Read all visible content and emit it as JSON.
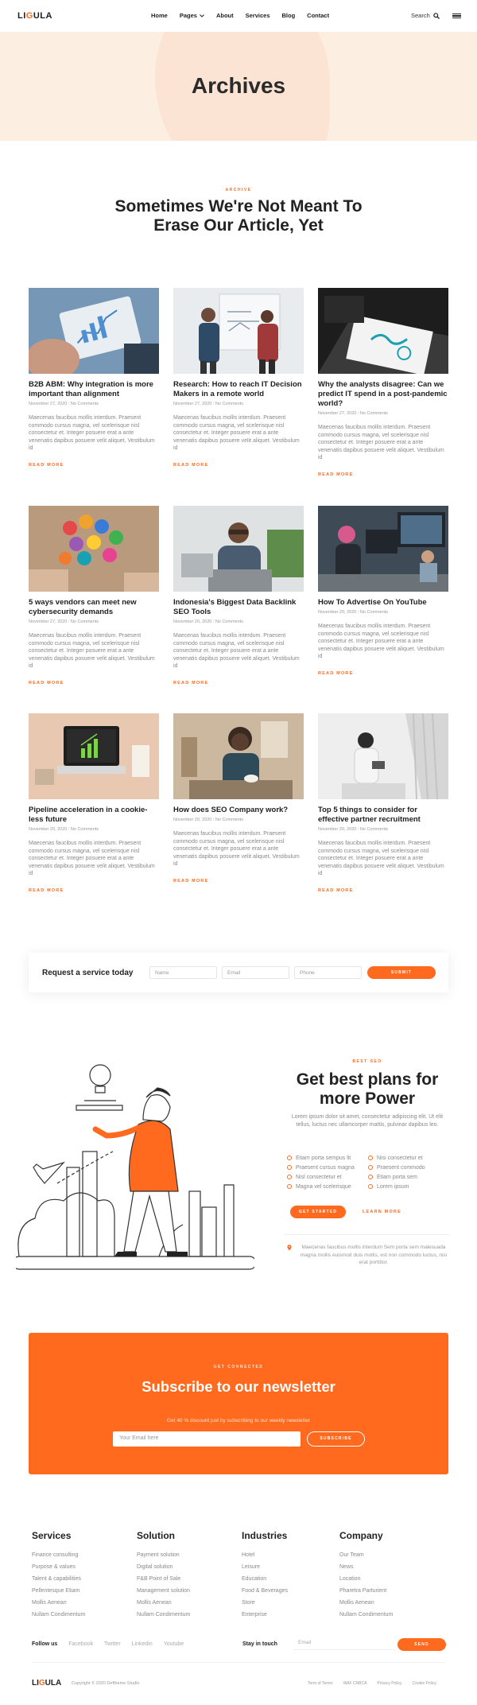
{
  "header": {
    "logo_prefix": "LI",
    "logo_accent": "G",
    "logo_suffix": "ULA",
    "nav": [
      "Home",
      "Pages",
      "About",
      "Services",
      "Blog",
      "Contact"
    ],
    "search_label": "Search"
  },
  "hero": {
    "title": "Archives"
  },
  "archive": {
    "eyebrow": "ARCHIVE",
    "title": "Sometimes We're Not Meant To Erase Our Article, Yet"
  },
  "posts": [
    {
      "title": "B2B ABM: Why integration is more important than alignment",
      "date": "November 27, 2020",
      "comments": "No Comments",
      "excerpt": "Maecenas faucibus mollis interdum. Praesent commodo cursus magna, vel scelerisque nisl consectetur et. Integer posuere erat a ante venenatis dapibus posuere velit aliquet. Vestibulum id",
      "more": "READ MORE"
    },
    {
      "title": "Research: How to reach IT Decision Makers in a remote world",
      "date": "November 27, 2020",
      "comments": "No Comments",
      "excerpt": "Maecenas faucibus mollis interdum. Praesent commodo cursus magna, vel scelerisque nisl consectetur et. Integer posuere erat a ante venenatis dapibus posuere velit aliquet. Vestibulum id",
      "more": "READ MORE"
    },
    {
      "title": "Why the analysts disagree: Can we predict IT spend in a post-pandemic world?",
      "date": "November 27, 2020",
      "comments": "No Comments",
      "excerpt": "Maecenas faucibus mollis interdum. Praesent commodo cursus magna, vel scelerisque nisl consectetur et. Integer posuere erat a ante venenatis dapibus posuere velit aliquet. Vestibulum id",
      "more": "READ MORE"
    },
    {
      "title": "5 ways vendors can meet new cybersecurity demands",
      "date": "November 27, 2020",
      "comments": "No Comments",
      "excerpt": "Maecenas faucibus mollis interdum. Praesent commodo cursus magna, vel scelerisque nisl consectetur et. Integer posuere erat a ante venenatis dapibus posuere velit aliquet. Vestibulum id",
      "more": "READ MORE"
    },
    {
      "title": "Indonesia's Biggest Data Backlink SEO Tools",
      "date": "November 20, 2020",
      "comments": "No Comments",
      "excerpt": "Maecenas faucibus mollis interdum. Praesent commodo cursus magna, vel scelerisque nisl consectetur et. Integer posuere erat a ante venenatis dapibus posuere velit aliquet. Vestibulum id",
      "more": "READ MORE"
    },
    {
      "title": "How To Advertise On YouTube",
      "date": "November 20, 2020",
      "comments": "No Comments",
      "excerpt": "Maecenas faucibus mollis interdum. Praesent commodo cursus magna, vel scelerisque nisl consectetur et. Integer posuere erat a ante venenatis dapibus posuere velit aliquet. Vestibulum id",
      "more": "READ MORE"
    },
    {
      "title": "Pipeline acceleration in a cookie-less future",
      "date": "November 20, 2020",
      "comments": "No Comments",
      "excerpt": "Maecenas faucibus mollis interdum. Praesent commodo cursus magna, vel scelerisque nisl consectetur et. Integer posuere erat a ante venenatis dapibus posuere velit aliquet. Vestibulum id",
      "more": "READ MORE"
    },
    {
      "title": "How does SEO Company work?",
      "date": "November 20, 2020",
      "comments": "No Comments",
      "excerpt": "Maecenas faucibus mollis interdum. Praesent commodo cursus magna, vel scelerisque nisl consectetur et. Integer posuere erat a ante venenatis dapibus posuere velit aliquet. Vestibulum id",
      "more": "READ MORE"
    },
    {
      "title": "Top 5 things to consider for effective partner recruitment",
      "date": "November 20, 2020",
      "comments": "No Comments",
      "excerpt": "Maecenas faucibus mollis interdum. Praesent commodo cursus magna, vel scelerisque nisl consectetur et. Integer posuere erat a ante venenatis dapibus posuere velit aliquet. Vestibulum id",
      "more": "READ MORE"
    }
  ],
  "request": {
    "label": "Request a service today",
    "name_placeholder": "Name",
    "email_placeholder": "Email",
    "phone_placeholder": "Phone",
    "submit": "SUBMIT"
  },
  "plans": {
    "eyebrow": "BEST SEO",
    "title": "Get best plans for more Power",
    "text": "Lorem ipsum dolor sit amet, consectetur adipiscing elit. Ut elit tellus, luctus nec ullamcorper mattis, pulvinar dapibus leo.",
    "list_left": [
      "Etiam porta sempus lit",
      "Praesent cursus magna",
      "Nisl consectetur et",
      "Magna vel scelerisque"
    ],
    "list_right": [
      "Nisi consectetur et",
      "Praesent commodo",
      "Etiam porta sem",
      "Lorem ipsum"
    ],
    "button": "GET STARTED",
    "link": "LEARN MORE",
    "note": "Maecenas faucibus mollis interdum Sem porta sem malesuada magna mollis euismod duis mollis, est non commodo luctus, nisi erat porttitor."
  },
  "newsletter": {
    "eyebrow": "GET CONNECTED",
    "title": "Subscribe to our newsletter",
    "subtitle": "Get 40 % discount just by subscribing to our weekly newsletter",
    "placeholder": "Your Email here",
    "button": "SUBSCRIBE"
  },
  "footer": {
    "columns": [
      {
        "heading": "Services",
        "links": [
          "Finance consulting",
          "Purpose & values",
          "Talent & capabilities",
          "Pellentesque Etiam",
          "Mollis Aenean",
          "Nullam Condimentum"
        ]
      },
      {
        "heading": "Solution",
        "links": [
          "Payment solution",
          "Digital solution",
          "F&B Point of Sale",
          "Management solution",
          "Mollis Aenean",
          "Nullam Condimentum"
        ]
      },
      {
        "heading": "Industries",
        "links": [
          "Hotel",
          "Leisure",
          "Education",
          "Food & Beverages",
          "Store",
          "Enterprise"
        ]
      },
      {
        "heading": "Company",
        "links": [
          "Our Team",
          "News",
          "Location",
          "Pharetra Parturient",
          "Mollis Aenean",
          "Nullam Condimentum"
        ]
      }
    ],
    "follow_label": "Follow us",
    "socials": [
      "Facebook",
      "Twitter",
      "Linkedin",
      "Youtube"
    ],
    "stay_label": "Stay in touch",
    "email_placeholder": "Email",
    "send": "SEND",
    "logo_prefix": "LI",
    "logo_accent": "G",
    "logo_suffix": "ULA",
    "copyright": "Copyright © 2020 Deftheme Studio",
    "legal": [
      "Term of Terms",
      "WAF CNBCA",
      "Privacy Policy",
      "Cookie Policy"
    ]
  },
  "colors": {
    "accent": "#ff6a1f",
    "hero_bg": "#fdeee2",
    "text_dark": "#222222",
    "text_muted": "#888888"
  }
}
